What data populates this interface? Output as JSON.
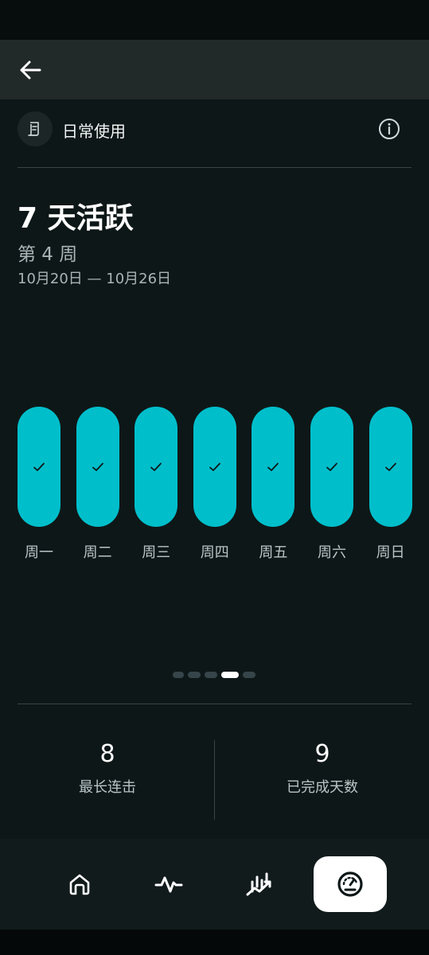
{
  "header": {
    "section_title": "日常使用",
    "back_icon": "arrow-left-icon",
    "section_icon": "calendar-note-icon",
    "info_icon": "info-icon"
  },
  "summary": {
    "title": "7 天活跃",
    "week": "第 4 周",
    "date_range": "10月20日 — 10月26日"
  },
  "days": [
    {
      "label": "周一",
      "completed": true
    },
    {
      "label": "周二",
      "completed": true
    },
    {
      "label": "周三",
      "completed": true
    },
    {
      "label": "周四",
      "completed": true
    },
    {
      "label": "周五",
      "completed": true
    },
    {
      "label": "周六",
      "completed": true
    },
    {
      "label": "周日",
      "completed": true
    }
  ],
  "pager": {
    "count": 5,
    "active_index": 3
  },
  "stats": {
    "longest_streak": {
      "value": "8",
      "label": "最长连击"
    },
    "completed_days": {
      "value": "9",
      "label": "已完成天数"
    }
  },
  "nav": {
    "items": [
      {
        "icon": "home-icon",
        "active": false
      },
      {
        "icon": "activity-icon",
        "active": false
      },
      {
        "icon": "trend-chart-icon",
        "active": false
      },
      {
        "icon": "dashboard-gauge-icon",
        "active": true
      }
    ]
  },
  "colors": {
    "accent": "#00bfcb",
    "background": "#0e1718",
    "appbar": "#212929"
  }
}
